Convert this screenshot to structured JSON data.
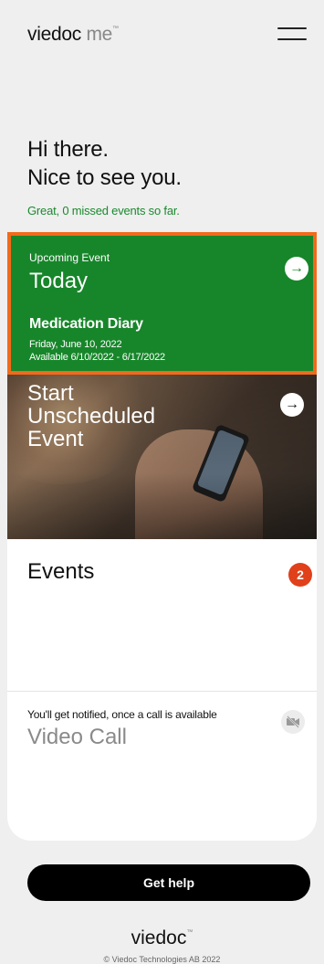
{
  "header": {
    "logo_brand": "viedoc",
    "logo_suffix": "me",
    "logo_mark": "™"
  },
  "greeting": {
    "line1": "Hi there.",
    "line2": "Nice to see you.",
    "missed_status": "Great, 0 missed events so far."
  },
  "upcoming_event": {
    "label": "Upcoming Event",
    "title": "Today",
    "name": "Medication Diary",
    "date": "Friday, June 10, 2022",
    "available": "Available 6/10/2022 - 6/17/2022",
    "arrow": "→"
  },
  "unscheduled": {
    "line1": "Start",
    "line2": "Unscheduled",
    "line3": "Event",
    "arrow": "→"
  },
  "events": {
    "title": "Events",
    "count": "2"
  },
  "video_call": {
    "notice": "You'll get notified, once a call is available",
    "title": "Video Call",
    "icon": "video-off-icon"
  },
  "footer": {
    "help_label": "Get help",
    "logo": "viedoc",
    "logo_mark": "™",
    "copyright": "© Viedoc Technologies AB 2022"
  },
  "colors": {
    "accent_green": "#17862a",
    "highlight_orange": "#f26a1b",
    "badge_red": "#e0401a"
  }
}
